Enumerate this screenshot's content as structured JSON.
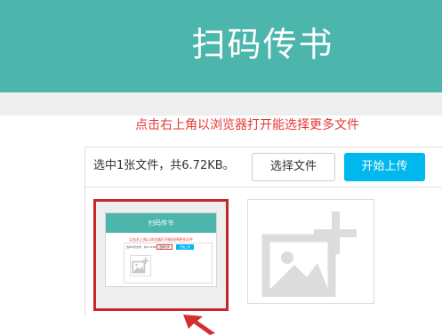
{
  "header": {
    "title": "扫码传书"
  },
  "hint": {
    "text": "点击右上角以浏览器打开能选择更多文件"
  },
  "uploader": {
    "status_text": "选中1张文件，共6.72KB。",
    "select_button": "选择文件",
    "upload_button": "开始上传"
  },
  "thumbnail": {
    "title": "扫码传书",
    "hint": "点击右上角以浏览器打开能选择更多文件",
    "status_text": "选中1张文件，共6.72KB。",
    "select_button": "选择文件",
    "upload_button": "开始上传"
  },
  "colors": {
    "header": "#4db6ac",
    "hint": "#e53935",
    "upload_button": "#00b7ee",
    "highlight_border": "#c62828",
    "arrow": "#d32f2f"
  },
  "icons": {
    "add_image": "image-plus-icon",
    "pointer": "red-arrow-icon"
  }
}
